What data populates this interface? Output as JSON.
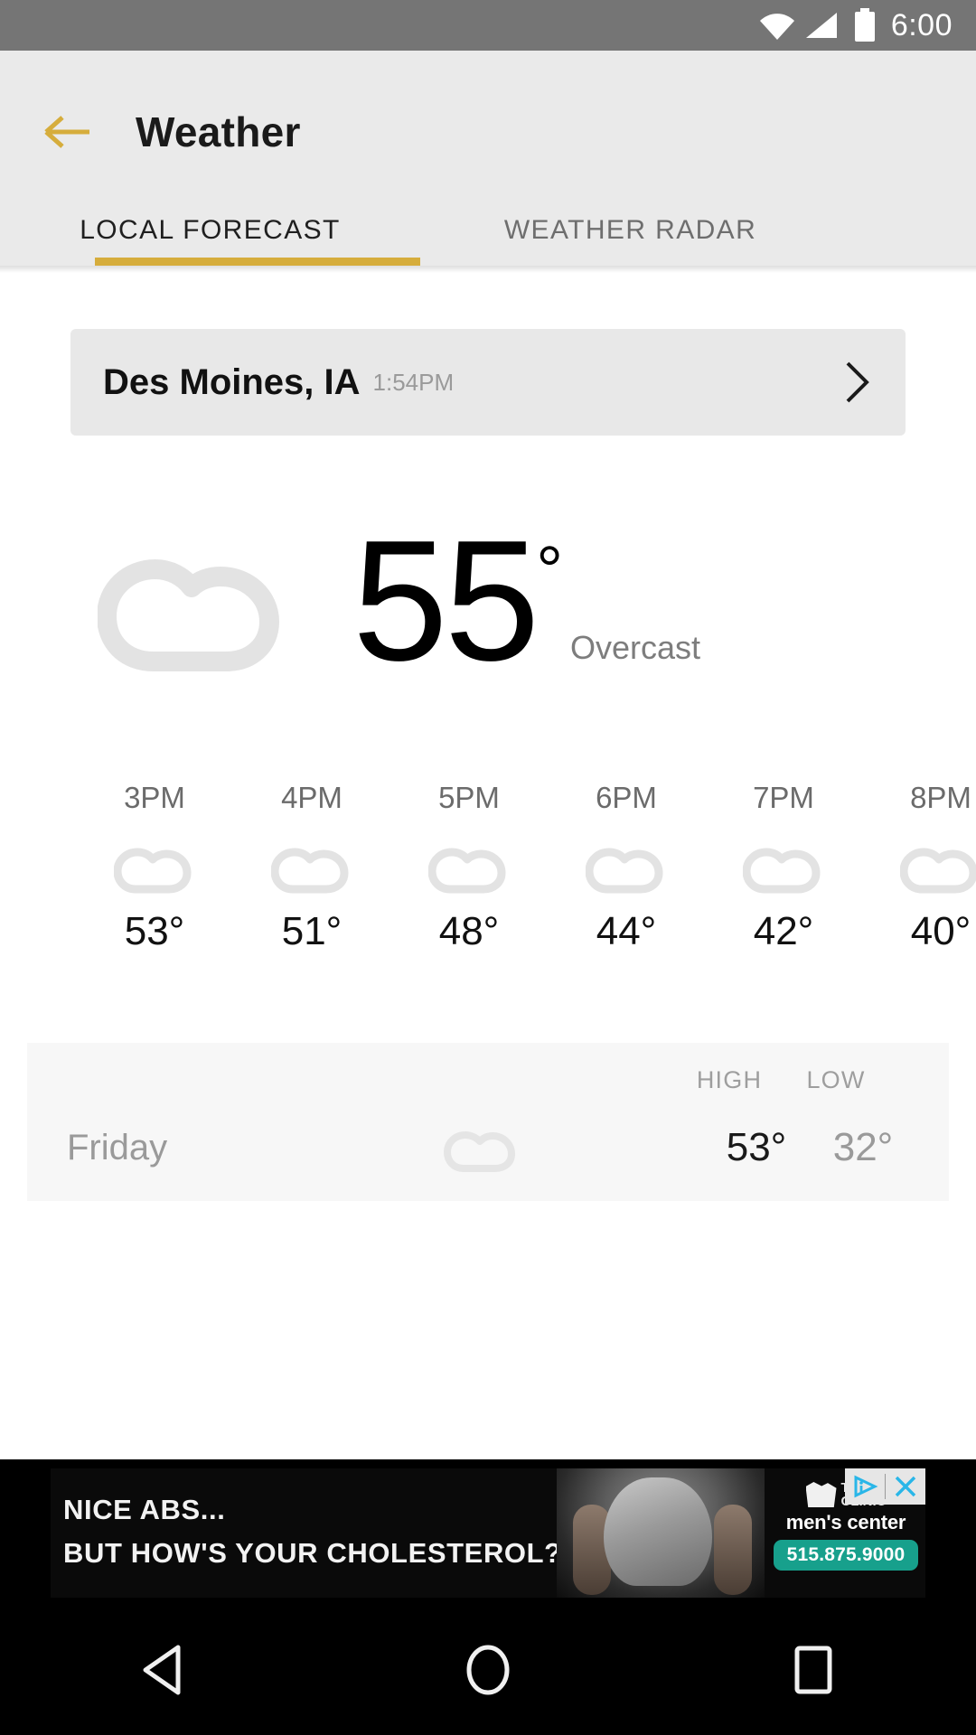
{
  "statusbar": {
    "clock": "6:00",
    "icons": [
      "wifi-icon",
      "cell-signal-icon",
      "battery-icon"
    ]
  },
  "appbar": {
    "back_icon": "arrow-left-icon",
    "title": "Weather",
    "accent_color": "#d6ad3c",
    "background_color": "#eaeaea"
  },
  "tabs": [
    {
      "label": "LOCAL FORECAST",
      "selected": true
    },
    {
      "label": "WEATHER RADAR",
      "selected": false
    }
  ],
  "location_card": {
    "name": "Des Moines, IA",
    "time": "1:54PM",
    "chevron_icon": "chevron-right-icon"
  },
  "current": {
    "icon": "cloud-icon",
    "temperature": "55",
    "degree": "°",
    "condition": "Overcast"
  },
  "hourly": {
    "items": [
      {
        "time": "3PM",
        "icon": "cloud-icon",
        "temp": "53°"
      },
      {
        "time": "4PM",
        "icon": "cloud-icon",
        "temp": "51°"
      },
      {
        "time": "5PM",
        "icon": "cloud-icon",
        "temp": "48°"
      },
      {
        "time": "6PM",
        "icon": "cloud-icon",
        "temp": "44°"
      },
      {
        "time": "7PM",
        "icon": "cloud-icon",
        "temp": "42°"
      },
      {
        "time": "8PM",
        "icon": "cloud-icon",
        "temp": "40°"
      }
    ]
  },
  "daily": {
    "header_high": "HIGH",
    "header_low": "LOW",
    "rows": [
      {
        "day": "Friday",
        "icon": "cloud-icon",
        "high": "53°",
        "low": "32°"
      }
    ]
  },
  "ad": {
    "line1": "NICE ABS...",
    "line2": "BUT HOW'S YOUR CHOLESTEROL?",
    "brand_line1": "THE",
    "brand_line2": "CLINIC",
    "brand_sub": "men's center",
    "phone": "515.875.9000",
    "phone_badge_color": "#17a08c",
    "adchoices_icon": "adchoices-icon",
    "close_icon": "close-icon"
  },
  "navbar": {
    "back": "back-triangle-icon",
    "home": "home-circle-icon",
    "recents": "recents-square-icon"
  }
}
